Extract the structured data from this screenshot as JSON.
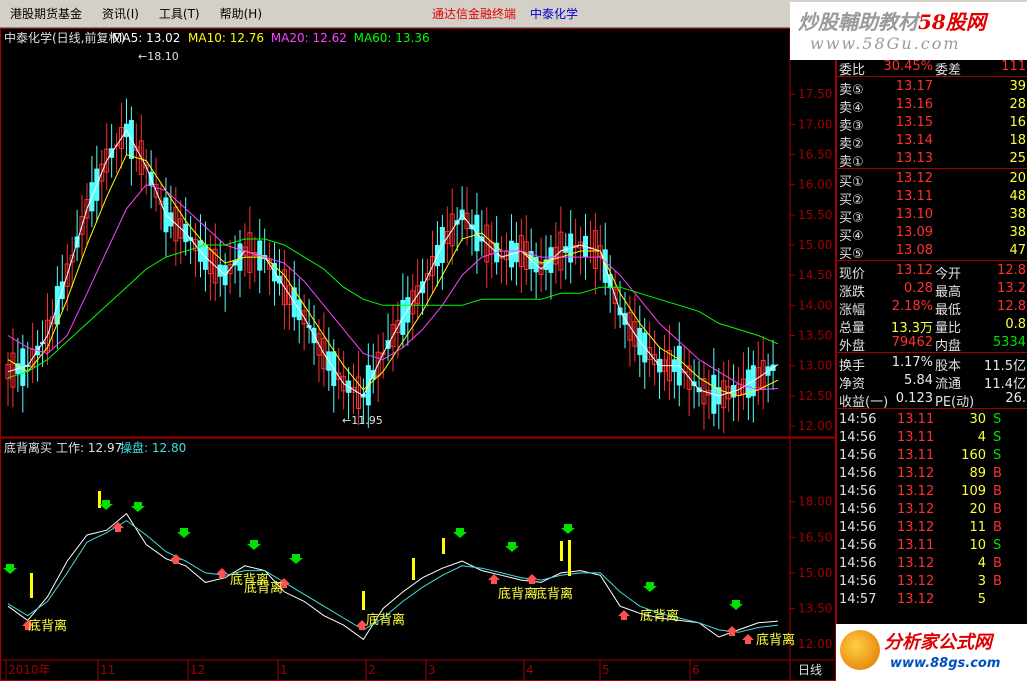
{
  "menu": {
    "items": [
      "港股期货基金",
      "资讯(I)",
      "工具(T)",
      "帮助(H)"
    ],
    "title_app": "通达信金融终端",
    "title_stock": "中泰化学"
  },
  "watermark_top": {
    "text_gray": "炒股輔助教材",
    "text_red": "58股网",
    "url": "www.58Gu.com"
  },
  "watermark_bottom": {
    "text": "分析家公式网",
    "url": "www.88gs.com"
  },
  "main_chart": {
    "title": "中泰化学(日线,前复权)",
    "ma_labels": [
      {
        "text": "MA5: 13.02",
        "color": "#ffffff"
      },
      {
        "text": "MA10: 12.76",
        "color": "#ffff00"
      },
      {
        "text": "MA20: 12.62",
        "color": "#ff40ff"
      },
      {
        "text": "MA60: 13.36",
        "color": "#00ff00"
      }
    ],
    "high_label": "18.10",
    "low_label": "11.95",
    "y_ticks": [
      "17.50",
      "17.00",
      "16.50",
      "16.00",
      "15.50",
      "15.00",
      "14.50",
      "14.00",
      "13.50",
      "13.00",
      "12.50",
      "12.00"
    ],
    "ymin": 11.8,
    "ymax": 18.3
  },
  "sub_chart": {
    "title": "底背离买",
    "work_label": "工作: 12.97",
    "ctrl_label": "操盘: 12.80",
    "y_ticks": [
      "18.00",
      "16.50",
      "15.00",
      "13.50",
      "12.00"
    ],
    "ymin": 11.5,
    "ymax": 19.0,
    "signal_text": "底背离"
  },
  "x_axis": {
    "labels": [
      "2010年",
      "11",
      "12",
      "1",
      "2",
      "3",
      "4",
      "5",
      "6"
    ],
    "period": "日线"
  },
  "chart_data": {
    "type": "line",
    "title": "中泰化学(日线,前复权)",
    "series": [
      {
        "name": "MA5: 13.02",
        "values": [
          12.9,
          13.0,
          13.5,
          14.5,
          15.6,
          16.4,
          16.9,
          16.3,
          15.5,
          15.2,
          14.8,
          14.5,
          14.9,
          14.8,
          14.3,
          13.8,
          13.2,
          12.7,
          12.5,
          13.2,
          13.8,
          14.3,
          15.0,
          15.5,
          15.1,
          14.8,
          14.9,
          14.6,
          14.9,
          15.0,
          14.9,
          13.9,
          13.4,
          13.0,
          13.0,
          12.6,
          12.5,
          12.6,
          12.8,
          13.02
        ]
      },
      {
        "name": "MA10: 12.76",
        "values": [
          13.1,
          12.9,
          13.3,
          14.1,
          15.0,
          15.8,
          16.5,
          16.4,
          15.9,
          15.4,
          15.0,
          14.7,
          14.8,
          14.8,
          14.5,
          14.0,
          13.5,
          13.0,
          12.6,
          12.9,
          13.4,
          13.9,
          14.5,
          15.1,
          15.2,
          14.9,
          14.9,
          14.7,
          14.8,
          14.9,
          14.9,
          14.2,
          13.7,
          13.3,
          13.1,
          12.8,
          12.6,
          12.5,
          12.6,
          12.76
        ]
      },
      {
        "name": "MA20: 12.62",
        "values": [
          13.5,
          13.3,
          13.2,
          13.5,
          14.2,
          14.9,
          15.6,
          16.0,
          15.9,
          15.6,
          15.3,
          15.0,
          14.9,
          14.8,
          14.7,
          14.4,
          14.0,
          13.6,
          13.2,
          13.1,
          13.3,
          13.6,
          14.0,
          14.5,
          14.8,
          14.9,
          14.9,
          14.8,
          14.8,
          14.8,
          14.8,
          14.5,
          14.1,
          13.7,
          13.4,
          13.1,
          12.9,
          12.7,
          12.6,
          12.62
        ]
      },
      {
        "name": "MA60: 13.36",
        "values": [
          12.8,
          12.9,
          13.1,
          13.4,
          13.7,
          14.0,
          14.3,
          14.6,
          14.8,
          14.9,
          15.0,
          15.0,
          15.1,
          15.1,
          15.0,
          14.8,
          14.6,
          14.3,
          14.1,
          14.0,
          14.0,
          14.0,
          14.0,
          14.0,
          14.1,
          14.1,
          14.1,
          14.1,
          14.2,
          14.2,
          14.3,
          14.3,
          14.2,
          14.1,
          14.0,
          13.9,
          13.7,
          13.6,
          13.5,
          13.36
        ]
      },
      {
        "name": "工作: 12.97",
        "values": [
          13.6,
          13.0,
          14.0,
          15.5,
          16.6,
          16.8,
          17.5,
          16.2,
          15.6,
          15.3,
          14.6,
          14.8,
          15.3,
          15.1,
          14.2,
          13.8,
          13.2,
          12.8,
          12.2,
          13.5,
          14.2,
          14.8,
          15.2,
          15.5,
          15.1,
          14.9,
          14.7,
          14.6,
          15.0,
          15.1,
          14.9,
          13.6,
          13.3,
          13.1,
          13.0,
          12.9,
          12.3,
          12.6,
          12.9,
          12.97
        ]
      },
      {
        "name": "操盘: 12.80",
        "values": [
          13.7,
          13.2,
          13.8,
          15.0,
          16.3,
          16.7,
          17.2,
          16.6,
          15.9,
          15.5,
          15.0,
          14.9,
          15.1,
          15.1,
          14.6,
          14.1,
          13.6,
          13.1,
          12.6,
          13.1,
          13.8,
          14.4,
          14.9,
          15.3,
          15.2,
          15.0,
          14.8,
          14.7,
          14.9,
          15.0,
          15.0,
          14.2,
          13.6,
          13.3,
          13.1,
          12.9,
          12.6,
          12.5,
          12.7,
          12.8
        ]
      }
    ],
    "ylim": [
      11.8,
      18.3
    ]
  },
  "quote": {
    "rows": [
      {
        "l": "委比",
        "v": "30.45%",
        "vc": "red",
        "l2": "委差",
        "v2": "111",
        "v2c": "red"
      },
      {
        "l": "卖⑤",
        "v": "13.17",
        "vc": "red",
        "v2": "39",
        "v2c": "yel"
      },
      {
        "l": "卖④",
        "v": "13.16",
        "vc": "red",
        "v2": "28",
        "v2c": "yel"
      },
      {
        "l": "卖③",
        "v": "13.15",
        "vc": "red",
        "v2": "16",
        "v2c": "yel"
      },
      {
        "l": "卖②",
        "v": "13.14",
        "vc": "red",
        "v2": "18",
        "v2c": "yel"
      },
      {
        "l": "卖①",
        "v": "13.13",
        "vc": "red",
        "v2": "25",
        "v2c": "yel"
      },
      {
        "l": "买①",
        "v": "13.12",
        "vc": "red",
        "v2": "20",
        "v2c": "yel"
      },
      {
        "l": "买②",
        "v": "13.11",
        "vc": "red",
        "v2": "48",
        "v2c": "yel"
      },
      {
        "l": "买③",
        "v": "13.10",
        "vc": "red",
        "v2": "38",
        "v2c": "yel"
      },
      {
        "l": "买④",
        "v": "13.09",
        "vc": "red",
        "v2": "38",
        "v2c": "yel"
      },
      {
        "l": "买⑤",
        "v": "13.08",
        "vc": "red",
        "v2": "47",
        "v2c": "yel"
      },
      {
        "l": "现价",
        "v": "13.12",
        "vc": "red",
        "l2": "今开",
        "v2": "12.8",
        "v2c": "red"
      },
      {
        "l": "涨跌",
        "v": "0.28",
        "vc": "red",
        "l2": "最高",
        "v2": "13.2",
        "v2c": "red"
      },
      {
        "l": "涨幅",
        "v": "2.18%",
        "vc": "red",
        "l2": "最低",
        "v2": "12.8",
        "v2c": "red"
      },
      {
        "l": "总量",
        "v": "13.3万",
        "vc": "yel",
        "l2": "量比",
        "v2": "0.8",
        "v2c": "yel"
      },
      {
        "l": "外盘",
        "v": "79462",
        "vc": "red",
        "l2": "内盘",
        "v2": "5334",
        "v2c": "grn"
      },
      {
        "l": "换手",
        "v": "1.17%",
        "vc": "wht",
        "l2": "股本",
        "v2": "11.5亿",
        "v2c": "wht"
      },
      {
        "l": "净资",
        "v": "5.84",
        "vc": "wht",
        "l2": "流通",
        "v2": "11.4亿",
        "v2c": "wht"
      },
      {
        "l": "收益(一)",
        "v": "0.123",
        "vc": "wht",
        "l2": "PE(动)",
        "v2": "26.",
        "v2c": "wht"
      }
    ],
    "ticks": [
      {
        "t": "14:56",
        "p": "13.11",
        "v": "30",
        "d": "S"
      },
      {
        "t": "14:56",
        "p": "13.11",
        "v": "4",
        "d": "S"
      },
      {
        "t": "14:56",
        "p": "13.11",
        "v": "160",
        "d": "S"
      },
      {
        "t": "14:56",
        "p": "13.12",
        "v": "89",
        "d": "B"
      },
      {
        "t": "14:56",
        "p": "13.12",
        "v": "109",
        "d": "B"
      },
      {
        "t": "14:56",
        "p": "13.12",
        "v": "20",
        "d": "B"
      },
      {
        "t": "14:56",
        "p": "13.12",
        "v": "11",
        "d": "B"
      },
      {
        "t": "14:56",
        "p": "13.11",
        "v": "10",
        "d": "S"
      },
      {
        "t": "14:56",
        "p": "13.12",
        "v": "4",
        "d": "B"
      },
      {
        "t": "14:56",
        "p": "13.12",
        "v": "3",
        "d": "B"
      },
      {
        "t": "14:57",
        "p": "13.12",
        "v": "5",
        "d": ""
      }
    ]
  },
  "colors": {
    "grid": "#a00000",
    "up": "#ff3030",
    "down": "#54ffff",
    "signal_yellow": "#ffff00",
    "arrow_up": "#ff5050",
    "arrow_down": "#00e000"
  }
}
